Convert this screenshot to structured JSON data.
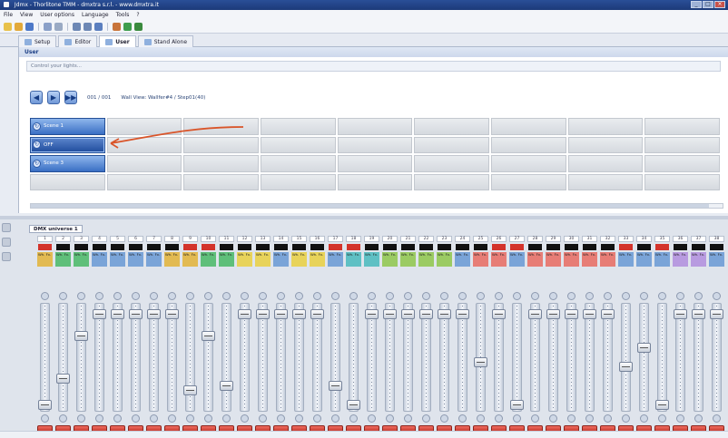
{
  "window": {
    "title": "Jdmx - Thorlitone TMM - dmxtra s.r.l. - www.dmxtra.it"
  },
  "menu": [
    "File",
    "View",
    "User options",
    "Language",
    "Tools",
    "?"
  ],
  "toolbar_icons": [
    {
      "name": "new-file-icon",
      "color": "#e8c14a"
    },
    {
      "name": "open-folder-icon",
      "color": "#e2a93a"
    },
    {
      "name": "save-icon",
      "color": "#4d79c8"
    },
    {
      "name": "undo-icon",
      "color": "#8aa0c8"
    },
    {
      "name": "cut-icon",
      "color": "#9aaac4"
    },
    {
      "name": "grid-icon",
      "color": "#6d88b5"
    },
    {
      "name": "list-icon",
      "color": "#6d88b5"
    },
    {
      "name": "chart-icon",
      "color": "#5b7fbf"
    },
    {
      "name": "pencil-icon",
      "color": "#c8743a"
    },
    {
      "name": "globe-icon",
      "color": "#3e9d4d"
    },
    {
      "name": "settings-icon",
      "color": "#3a8a3e"
    }
  ],
  "tabs": [
    {
      "label": "Setup",
      "active": false
    },
    {
      "label": "Editor",
      "active": false
    },
    {
      "label": "User",
      "active": true
    },
    {
      "label": "Stand Alone",
      "active": false
    }
  ],
  "user_panel": {
    "header": "User",
    "control_strip": "Control your lights...",
    "nav": {
      "position": "001 / 001",
      "info": "Wall View: Wallfer#4 / Step01(40)"
    },
    "scenes": [
      {
        "label": "Scene 1",
        "selected": false
      },
      {
        "label": "OFF",
        "selected": true
      },
      {
        "label": "Scene 3",
        "selected": false
      }
    ],
    "grid": {
      "columns": 9,
      "rows": 4
    }
  },
  "fader_section": {
    "universe_tab": "DMX universe 1",
    "channels": [
      {
        "num": "1",
        "led": true,
        "color": "#e2ba52",
        "text": "Wh.\nFx.",
        "fader": 0.0
      },
      {
        "num": "2",
        "led": false,
        "color": "#5fbf7a",
        "text": "Wh.\nFx.",
        "fader": 0.28
      },
      {
        "num": "3",
        "led": false,
        "color": "#5fbf7a",
        "text": "Wh.\nFx.",
        "fader": 0.72
      },
      {
        "num": "4",
        "led": false,
        "color": "#7aa4d8",
        "text": "Wh.\nFx.",
        "fader": 0.95
      },
      {
        "num": "5",
        "led": false,
        "color": "#7aa4d8",
        "text": "Wh.\nFx.",
        "fader": 0.95
      },
      {
        "num": "6",
        "led": false,
        "color": "#7aa4d8",
        "text": "Wh.\nFx.",
        "fader": 0.95
      },
      {
        "num": "7",
        "led": false,
        "color": "#7aa4d8",
        "text": "Wh.\nFx.",
        "fader": 0.95
      },
      {
        "num": "8",
        "led": false,
        "color": "#e2ba52",
        "text": "Wh.\nFx.",
        "fader": 0.95
      },
      {
        "num": "9",
        "led": true,
        "color": "#e2ba52",
        "text": "Wh.\nFx.",
        "fader": 0.15
      },
      {
        "num": "10",
        "led": true,
        "color": "#5fbf7a",
        "text": "Wh.\nFx.",
        "fader": 0.72
      },
      {
        "num": "11",
        "led": false,
        "color": "#5fbf7a",
        "text": "Wh.\nFx.",
        "fader": 0.2
      },
      {
        "num": "12",
        "led": false,
        "color": "#e8d35a",
        "text": "Wh.\nFx.",
        "fader": 0.95
      },
      {
        "num": "13",
        "led": false,
        "color": "#e8d35a",
        "text": "Wh.\nFx.",
        "fader": 0.95
      },
      {
        "num": "14",
        "led": false,
        "color": "#7aa4d8",
        "text": "Wh.\nFx.",
        "fader": 0.95
      },
      {
        "num": "15",
        "led": false,
        "color": "#e8d35a",
        "text": "Wh.\nFx.",
        "fader": 0.95
      },
      {
        "num": "16",
        "led": false,
        "color": "#e8d35a",
        "text": "Wh.\nFx.",
        "fader": 0.95
      },
      {
        "num": "17",
        "led": true,
        "color": "#7aa4d8",
        "text": "Wh.\nFx.",
        "fader": 0.2
      },
      {
        "num": "18",
        "led": true,
        "color": "#5fc0c4",
        "text": "Wh.\nFx.",
        "fader": 0.0
      },
      {
        "num": "19",
        "led": false,
        "color": "#5fc0c4",
        "text": "Wh.\nFx.",
        "fader": 0.95
      },
      {
        "num": "20",
        "led": false,
        "color": "#9bcb63",
        "text": "Wh.\nFx.",
        "fader": 0.95
      },
      {
        "num": "21",
        "led": false,
        "color": "#9bcb63",
        "text": "Wh.\nFx.",
        "fader": 0.95
      },
      {
        "num": "22",
        "led": false,
        "color": "#9bcb63",
        "text": "Wh.\nFx.",
        "fader": 0.95
      },
      {
        "num": "23",
        "led": false,
        "color": "#9bcb63",
        "text": "Wh.\nFx.",
        "fader": 0.95
      },
      {
        "num": "24",
        "led": false,
        "color": "#7aa4d8",
        "text": "Wh.\nFx.",
        "fader": 0.95
      },
      {
        "num": "25",
        "led": false,
        "color": "#e77d76",
        "text": "Wh.\nFx.",
        "fader": 0.45
      },
      {
        "num": "26",
        "led": true,
        "color": "#e77d76",
        "text": "Wh.\nFx.",
        "fader": 0.95
      },
      {
        "num": "27",
        "led": true,
        "color": "#7aa4d8",
        "text": "Wh.\nFx.",
        "fader": 0.0
      },
      {
        "num": "28",
        "led": false,
        "color": "#e77d76",
        "text": "Wh.\nFx.",
        "fader": 0.95
      },
      {
        "num": "29",
        "led": false,
        "color": "#e77d76",
        "text": "Wh.\nFx.",
        "fader": 0.95
      },
      {
        "num": "30",
        "led": false,
        "color": "#e77d76",
        "text": "Wh.\nFx.",
        "fader": 0.95
      },
      {
        "num": "31",
        "led": false,
        "color": "#e77d76",
        "text": "Wh.\nFx.",
        "fader": 0.95
      },
      {
        "num": "32",
        "led": false,
        "color": "#e77d76",
        "text": "Wh.\nFx.",
        "fader": 0.95
      },
      {
        "num": "33",
        "led": true,
        "color": "#7aa4d8",
        "text": "Wh.\nFx.",
        "fader": 0.4
      },
      {
        "num": "34",
        "led": false,
        "color": "#7aa4d8",
        "text": "Wh.\nFx.",
        "fader": 0.6
      },
      {
        "num": "35",
        "led": true,
        "color": "#7aa4d8",
        "text": "Wh.\nFx.",
        "fader": 0.0
      },
      {
        "num": "36",
        "led": false,
        "color": "#b89be0",
        "text": "Wh.\nFx.",
        "fader": 0.95
      },
      {
        "num": "37",
        "led": false,
        "color": "#b89be0",
        "text": "Wh.\nFx.",
        "fader": 0.95
      },
      {
        "num": "38",
        "led": false,
        "color": "#7aa4d8",
        "text": "Wh.\nFx.",
        "fader": 0.95
      }
    ]
  }
}
